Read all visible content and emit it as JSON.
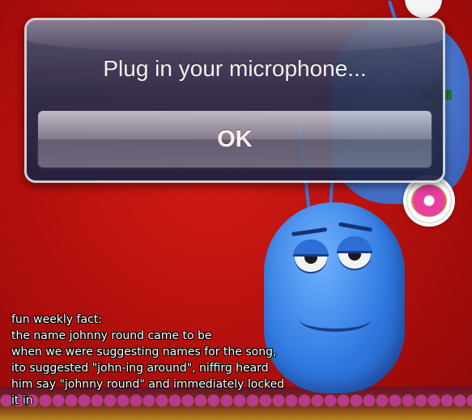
{
  "alert": {
    "message": "Plug in your microphone...",
    "ok_label": "OK"
  },
  "caption": {
    "lines": [
      "fun weekly fact:",
      "the name johnny round came to be",
      "when we were suggesting names for the song,",
      "ito suggested \"john-ing around\", niffirg heard",
      "him say \"johnny round\" and immediately locked",
      "it in"
    ]
  },
  "colors": {
    "background": "#c01510",
    "monster": "#3a7ee0",
    "alert": "#2c3150"
  },
  "icons": [
    "donut-icon",
    "clock-icon",
    "add-icon"
  ]
}
